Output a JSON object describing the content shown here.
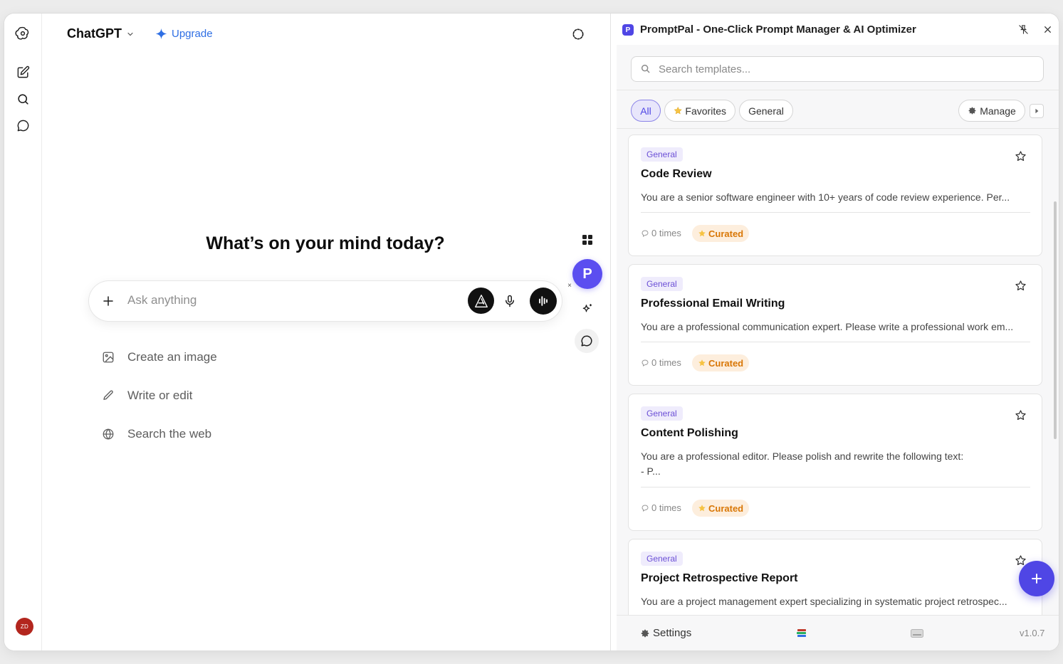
{
  "app": {
    "model_name": "ChatGPT",
    "upgrade_label": "Upgrade",
    "avatar_initials": "ZD",
    "avatar_color": "#b3261e"
  },
  "chat": {
    "headline": "What’s on your mind today?",
    "composer_placeholder": "Ask anything",
    "suggestions": [
      {
        "label": "Create an image",
        "icon": "image-icon"
      },
      {
        "label": "Write or edit",
        "icon": "pencil-icon"
      },
      {
        "label": "Search the web",
        "icon": "globe-icon"
      }
    ]
  },
  "panel": {
    "title": "PromptPal - One-Click Prompt Manager & AI Optimizer",
    "logo_letter": "P",
    "search_placeholder": "Search templates...",
    "filters": {
      "all": "All",
      "favorites": "Favorites",
      "general": "General",
      "manage": "Manage"
    },
    "cards": [
      {
        "tag": "General",
        "title": "Code Review",
        "description": "You are a senior software engineer with 10+ years of code review experience. Per...",
        "uses": "0 times",
        "badge": "Curated"
      },
      {
        "tag": "General",
        "title": "Professional Email Writing",
        "description": "You are a professional communication expert. Please write a professional work em...",
        "uses": "0 times",
        "badge": "Curated"
      },
      {
        "tag": "General",
        "title": "Content Polishing",
        "description": "You are a professional editor. Please polish and rewrite the following text:",
        "description_line2": "- P...",
        "uses": "0 times",
        "badge": "Curated"
      },
      {
        "tag": "General",
        "title": "Project Retrospective Report",
        "description": "You are a project management expert specializing in systematic project retrospec..."
      }
    ],
    "footer": {
      "settings_label": "Settings",
      "version": "v1.0.7"
    }
  },
  "floating_tools": {
    "promptpal_letter": "P",
    "dismiss": "×"
  },
  "colors": {
    "accent": "#4f46e5",
    "promptpal_button": "#5b4ef0",
    "upgrade_blue": "#2f6fe4",
    "curated_text": "#d97706",
    "curated_bg": "#fdeedd",
    "tag_text": "#6b4fd6",
    "tag_bg": "#efecfc"
  }
}
